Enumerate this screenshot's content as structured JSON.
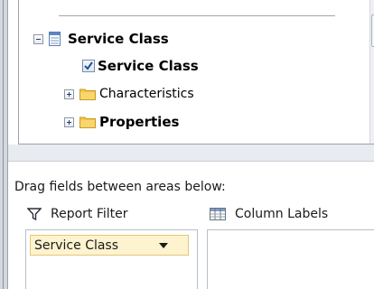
{
  "field_list": {
    "items": [
      {
        "label": "Service Class",
        "bold": true,
        "expander": "minus",
        "icon": "table-icon"
      },
      {
        "label": "Service Class",
        "bold": true,
        "checked": true
      },
      {
        "label": "Characteristics",
        "bold": false,
        "expander": "plus",
        "icon": "folder-icon"
      },
      {
        "label": "Properties",
        "bold": true,
        "expander": "plus",
        "icon": "folder-icon"
      }
    ]
  },
  "areas": {
    "instruction": "Drag fields between areas below:",
    "report_filter_label": "Report Filter",
    "column_labels_label": "Column Labels",
    "filter_fields": [
      {
        "label": "Service Class"
      }
    ]
  },
  "colors": {
    "chip_background": "#fdf3cf",
    "chip_border": "#e3c77a",
    "folder": "#f2c54c",
    "check": "#1f4f9a"
  }
}
